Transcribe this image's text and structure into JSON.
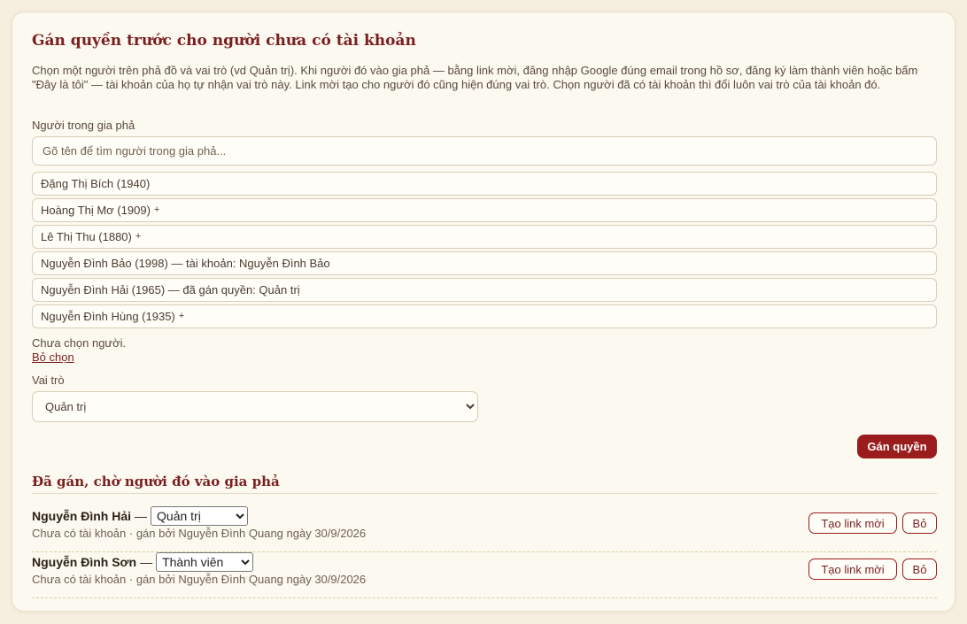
{
  "card": {
    "title": "Gán quyền trước cho người chưa có tài khoản",
    "description": "Chọn một người trên phả đồ và vai trò (vd Quản trị). Khi người đó vào gia phả — bằng link mời, đăng nhập Google đúng email trong hồ sơ, đăng ký làm thành viên hoặc bấm \"Đây là tôi\" — tài khoản của họ tự nhận vai trò này. Link mời tạo cho người đó cũng hiện đúng vai trò. Chọn người đã có tài khoản thì đổi luôn vai trò của tài khoản đó."
  },
  "person_field": {
    "label": "Người trong gia phả",
    "search_placeholder": "Gõ tên để tìm người trong gia phả...",
    "people": [
      {
        "text": "Đặng Thị Bích (1940)",
        "plus": ""
      },
      {
        "text": "Hoàng Thị Mơ (1909)",
        "plus": "+"
      },
      {
        "text": "Lê Thị Thu (1880)",
        "plus": "+"
      },
      {
        "text": "Nguyễn Đình Bảo (1998) — tài khoản: Nguyễn Đình Bảo",
        "plus": ""
      },
      {
        "text": "Nguyễn Đình Hải (1965) — đã gán quyền: Quản trị",
        "plus": ""
      },
      {
        "text": "Nguyễn Đình Hùng (1935)",
        "plus": "+"
      }
    ],
    "no_selection": "Chưa chọn người.",
    "unselect_link": "Bỏ chọn"
  },
  "role_field": {
    "label": "Vai trò",
    "selected": "Quản trị"
  },
  "assign_button": "Gán quyền",
  "pending": {
    "title": "Đã gán, chờ người đó vào gia phả",
    "separator": "—",
    "invite_label": "Tạo link mời",
    "remove_label": "Bỏ",
    "rows": [
      {
        "name": "Nguyễn Đình Hải",
        "role": "Quản trị",
        "note": "Chưa có tài khoản · gán bởi Nguyễn Đình Quang ngày 30/9/2026"
      },
      {
        "name": "Nguyễn Đình Sơn",
        "role": "Thành viên",
        "note": "Chưa có tài khoản · gán bởi Nguyễn Đình Quang ngày 30/9/2026"
      }
    ]
  },
  "colors": {
    "accent": "#9b1c1c",
    "title": "#7a1f1f",
    "background": "#f6efe0",
    "card": "#fcf9f1"
  }
}
